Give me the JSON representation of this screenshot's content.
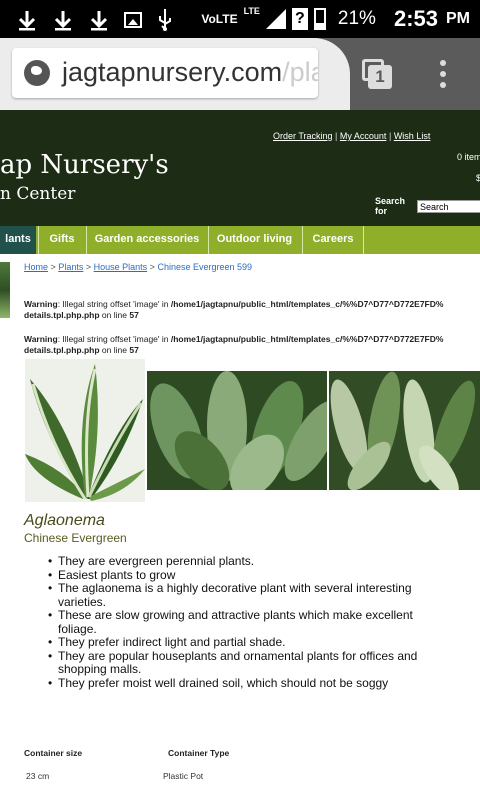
{
  "status_bar": {
    "network": "VoLTE",
    "lte": "LTE",
    "sim_badge": "?",
    "battery_percent": "21%",
    "time": "2:53",
    "ampm": "PM",
    "icons": [
      "download-icon",
      "download-icon",
      "download-icon",
      "image-icon",
      "usb-icon",
      "signal-icon",
      "sim-icon",
      "battery-icon"
    ]
  },
  "browser": {
    "url_main": "jagtapnursery.com",
    "url_rest": "/pla",
    "tab_count": "1"
  },
  "site": {
    "brand_title": "ap Nursery's",
    "brand_subtitle": "n Center",
    "toplinks": {
      "order_tracking": "Order Tracking",
      "separator": "|",
      "my_account": "My Account",
      "wish_list": "Wish List"
    },
    "cart_count": "0 item",
    "cart_total": "$",
    "search_label": "Search for",
    "search_value": "Search"
  },
  "nav": {
    "items": [
      "lants",
      "Gifts",
      "Garden accessories",
      "Outdoor living",
      "Careers"
    ],
    "active_index": 0
  },
  "breadcrumb": {
    "home": "Home",
    "plants": "Plants",
    "house_plants": "House Plants",
    "current": "Chinese Evergreen 599",
    "sep": ">"
  },
  "warnings": [
    {
      "label": "Warning",
      "text": ": Illegal string offset 'image' in ",
      "path": "/home1/jagtapnu/public_html/templates_c/%%D7^D77^D772E7FD%",
      "file": "details.tpl.php.php",
      "line_text": " on line ",
      "line": "57"
    },
    {
      "label": "Warning",
      "text": ": Illegal string offset 'image' in ",
      "path": "/home1/jagtapnu/public_html/templates_c/%%D7^D77^D772E7FD%",
      "file": "details.tpl.php.php",
      "line_text": " on line ",
      "line": "57"
    }
  ],
  "product": {
    "name": "Aglaonema",
    "common_name": "Chinese Evergreen",
    "features": [
      "They are evergreen perennial plants.",
      "Easiest plants to grow",
      "The aglaonema is a highly decorative plant with several interesting varieties.",
      "These are slow growing and attractive plants which make excellent foliage.",
      "They prefer indirect light and partial shade.",
      "They are popular houseplants and ornamental plants for offices and shopping malls.",
      "They prefer moist well drained soil, which should not be soggy"
    ]
  },
  "specs": {
    "container_size_label": "Container size",
    "container_type_label": "Container Type",
    "container_size": "23 cm",
    "container_type": "Plastic Pot"
  },
  "colors": {
    "header_bg": "#1d2d15",
    "nav_bg": "#8fae2a",
    "nav_active": "#20524b",
    "link": "#2b6cc4"
  }
}
